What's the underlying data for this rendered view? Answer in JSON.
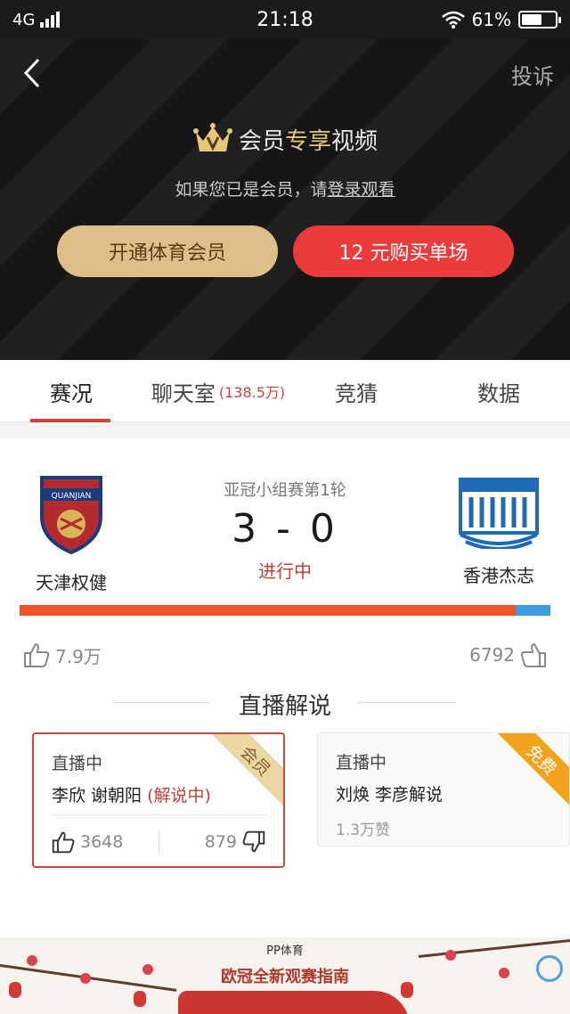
{
  "status_bar": {
    "network": "4G",
    "time": "21:18",
    "battery": "61%",
    "battery_level": 0.61
  },
  "header": {
    "report": "投诉"
  },
  "vip": {
    "title_prefix": "会员",
    "title_highlight": "专享",
    "title_suffix": "视频",
    "sub_prefix": "如果您已是会员，请",
    "sub_link": "登录观看",
    "member_button": "开通体育会员",
    "buy_button": "12 元购买单场"
  },
  "tabs": [
    {
      "label": "赛况",
      "count": ""
    },
    {
      "label": "聊天室",
      "count": "(138.5万)"
    },
    {
      "label": "竞猜",
      "count": ""
    },
    {
      "label": "数据",
      "count": ""
    }
  ],
  "match": {
    "home": {
      "name": "天津权健",
      "crest_text": "QUANJIAN"
    },
    "away": {
      "name": "香港杰志"
    },
    "stage": "亚冠小组赛第1轮",
    "score": "3 - 0",
    "status": "进行中",
    "support_home_fraction": 0.935,
    "home_likes": "7.9万",
    "away_likes": "6792",
    "colors": {
      "home": "#ef5327",
      "away": "#3e9be0"
    }
  },
  "commentary": {
    "title": "直播解说",
    "cards": [
      {
        "status": "直播中",
        "names": "李欣 谢朝阳",
        "note": "(解说中)",
        "badge": "会员",
        "likes": "3648",
        "dislikes": "879"
      },
      {
        "status": "直播中",
        "names": "刘焕 李彦解说",
        "badge": "免费",
        "likes": "1.3万赞"
      }
    ]
  },
  "banner": {
    "brand": "PP体育",
    "title": "欧冠全新观赛指南"
  }
}
